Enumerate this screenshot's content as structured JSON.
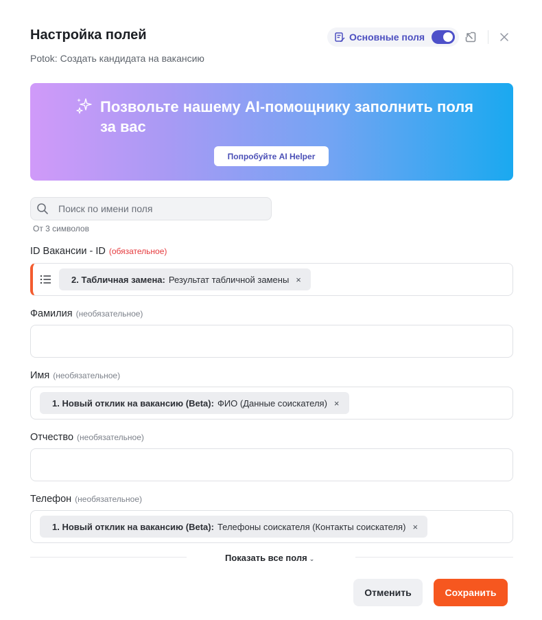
{
  "header": {
    "title": "Настройка полей",
    "subtitle": "Potok: Создать кандидата на вакансию",
    "mode_label": "Основные поля",
    "mode_toggle_on": true,
    "accent_color": "#4d50c9"
  },
  "ai_banner": {
    "headline": "Позвольте нашему AI-помощнику заполнить поля за вас",
    "button_label": "Попробуйте AI Helper"
  },
  "search": {
    "placeholder": "Поиск по имени поля",
    "value": "",
    "hint": "От 3 символов"
  },
  "fields": [
    {
      "label": "ID Вакансии - ID",
      "qualifier": "(обязательное)",
      "required": true,
      "chip": {
        "source": "2. Табличная замена:",
        "value": "Результат табличной замены",
        "remove": "×"
      }
    },
    {
      "label": "Фамилия",
      "qualifier": "(необязательное)",
      "required": false
    },
    {
      "label": "Имя",
      "qualifier": "(необязательное)",
      "required": false,
      "chip": {
        "source": "1. Новый отклик на вакансию (Beta):",
        "value": "ФИО (Данные соискателя)",
        "remove": "×"
      }
    },
    {
      "label": "Отчество",
      "qualifier": "(необязательное)",
      "required": false
    },
    {
      "label": "Телефон",
      "qualifier": "(необязательное)",
      "required": false,
      "chip": {
        "source": "1. Новый отклик на вакансию (Beta):",
        "value": "Телефоны соискателя (Контакты соискателя)",
        "remove": "×"
      }
    }
  ],
  "show_all": {
    "label": "Показать все поля",
    "chevron": "⌄"
  },
  "footer": {
    "cancel_label": "Отменить",
    "save_label": "Сохранить",
    "save_color": "#f6571f"
  }
}
